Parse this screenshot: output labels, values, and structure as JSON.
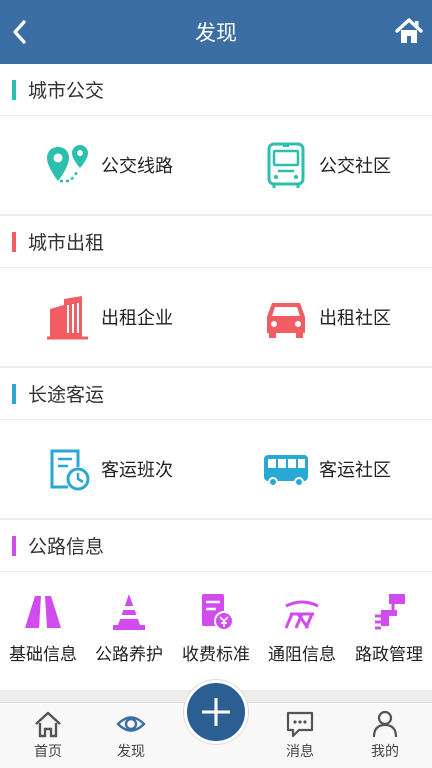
{
  "header": {
    "title": "发现"
  },
  "sections": [
    {
      "title": "城市公交",
      "color": "#2bbfae",
      "items": [
        {
          "label": "公交线路",
          "icon": "route-pin-icon"
        },
        {
          "label": "公交社区",
          "icon": "bus-front-icon"
        }
      ]
    },
    {
      "title": "城市出租",
      "color": "#f25c63",
      "items": [
        {
          "label": "出租企业",
          "icon": "building-icon"
        },
        {
          "label": "出租社区",
          "icon": "car-icon"
        }
      ]
    },
    {
      "title": "长途客运",
      "color": "#29a8d6",
      "items": [
        {
          "label": "客运班次",
          "icon": "schedule-clock-icon"
        },
        {
          "label": "客运社区",
          "icon": "coach-bus-icon"
        }
      ]
    },
    {
      "title": "公路信息",
      "color": "#d14cef",
      "items": [
        {
          "label": "基础信息",
          "icon": "road-icon"
        },
        {
          "label": "公路养护",
          "icon": "traffic-cone-icon"
        },
        {
          "label": "收费标准",
          "icon": "toll-fee-icon"
        },
        {
          "label": "通阻信息",
          "icon": "barrier-icon"
        },
        {
          "label": "路政管理",
          "icon": "road-admin-icon"
        }
      ]
    }
  ],
  "tabbar": {
    "tabs": [
      {
        "label": "首页",
        "icon": "home-icon"
      },
      {
        "label": "发现",
        "icon": "eye-icon"
      },
      {
        "label": "消息",
        "icon": "message-icon"
      },
      {
        "label": "我的",
        "icon": "user-icon"
      }
    ]
  }
}
